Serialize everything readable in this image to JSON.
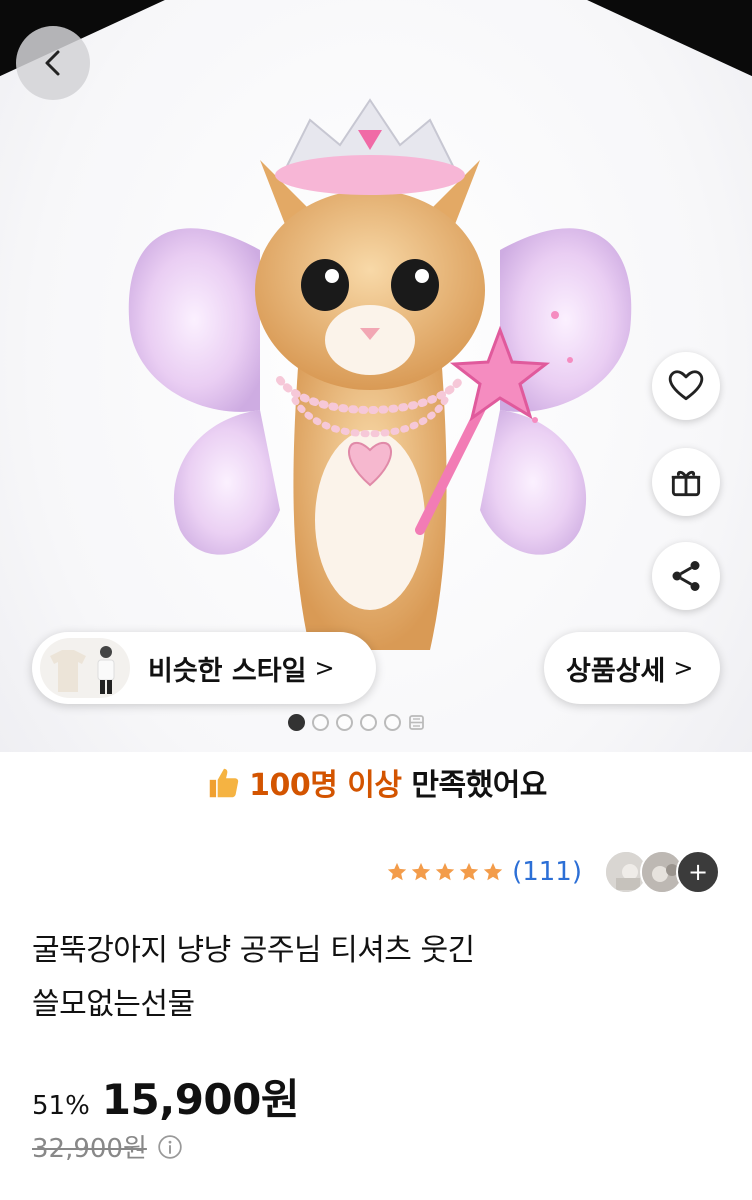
{
  "hero": {
    "similar_style_label": "비슷한 스타일",
    "product_detail_label": "상품상세",
    "chevron": ">",
    "carousel": {
      "count": 5,
      "active_index": 0
    }
  },
  "satisfaction": {
    "highlight": "100명 이상",
    "suffix": " 만족했어요"
  },
  "rating": {
    "stars": 5,
    "review_count": "(111)",
    "more_symbol": "+"
  },
  "product": {
    "title_line1": "굴뚝강아지 냥냥 공주님 티셔츠 웃긴",
    "title_line2": "쓸모없는선물",
    "discount": "51%",
    "price": "15,900원",
    "original_price": "32,900원"
  },
  "colors": {
    "accent_orange": "#d35400",
    "star": "#f39c4a",
    "link_blue": "#2c6fd6"
  },
  "icons": [
    "back-icon",
    "heart-icon",
    "gift-icon",
    "share-icon",
    "thumbs-up-icon",
    "star-icon",
    "info-icon",
    "grid-icon"
  ]
}
